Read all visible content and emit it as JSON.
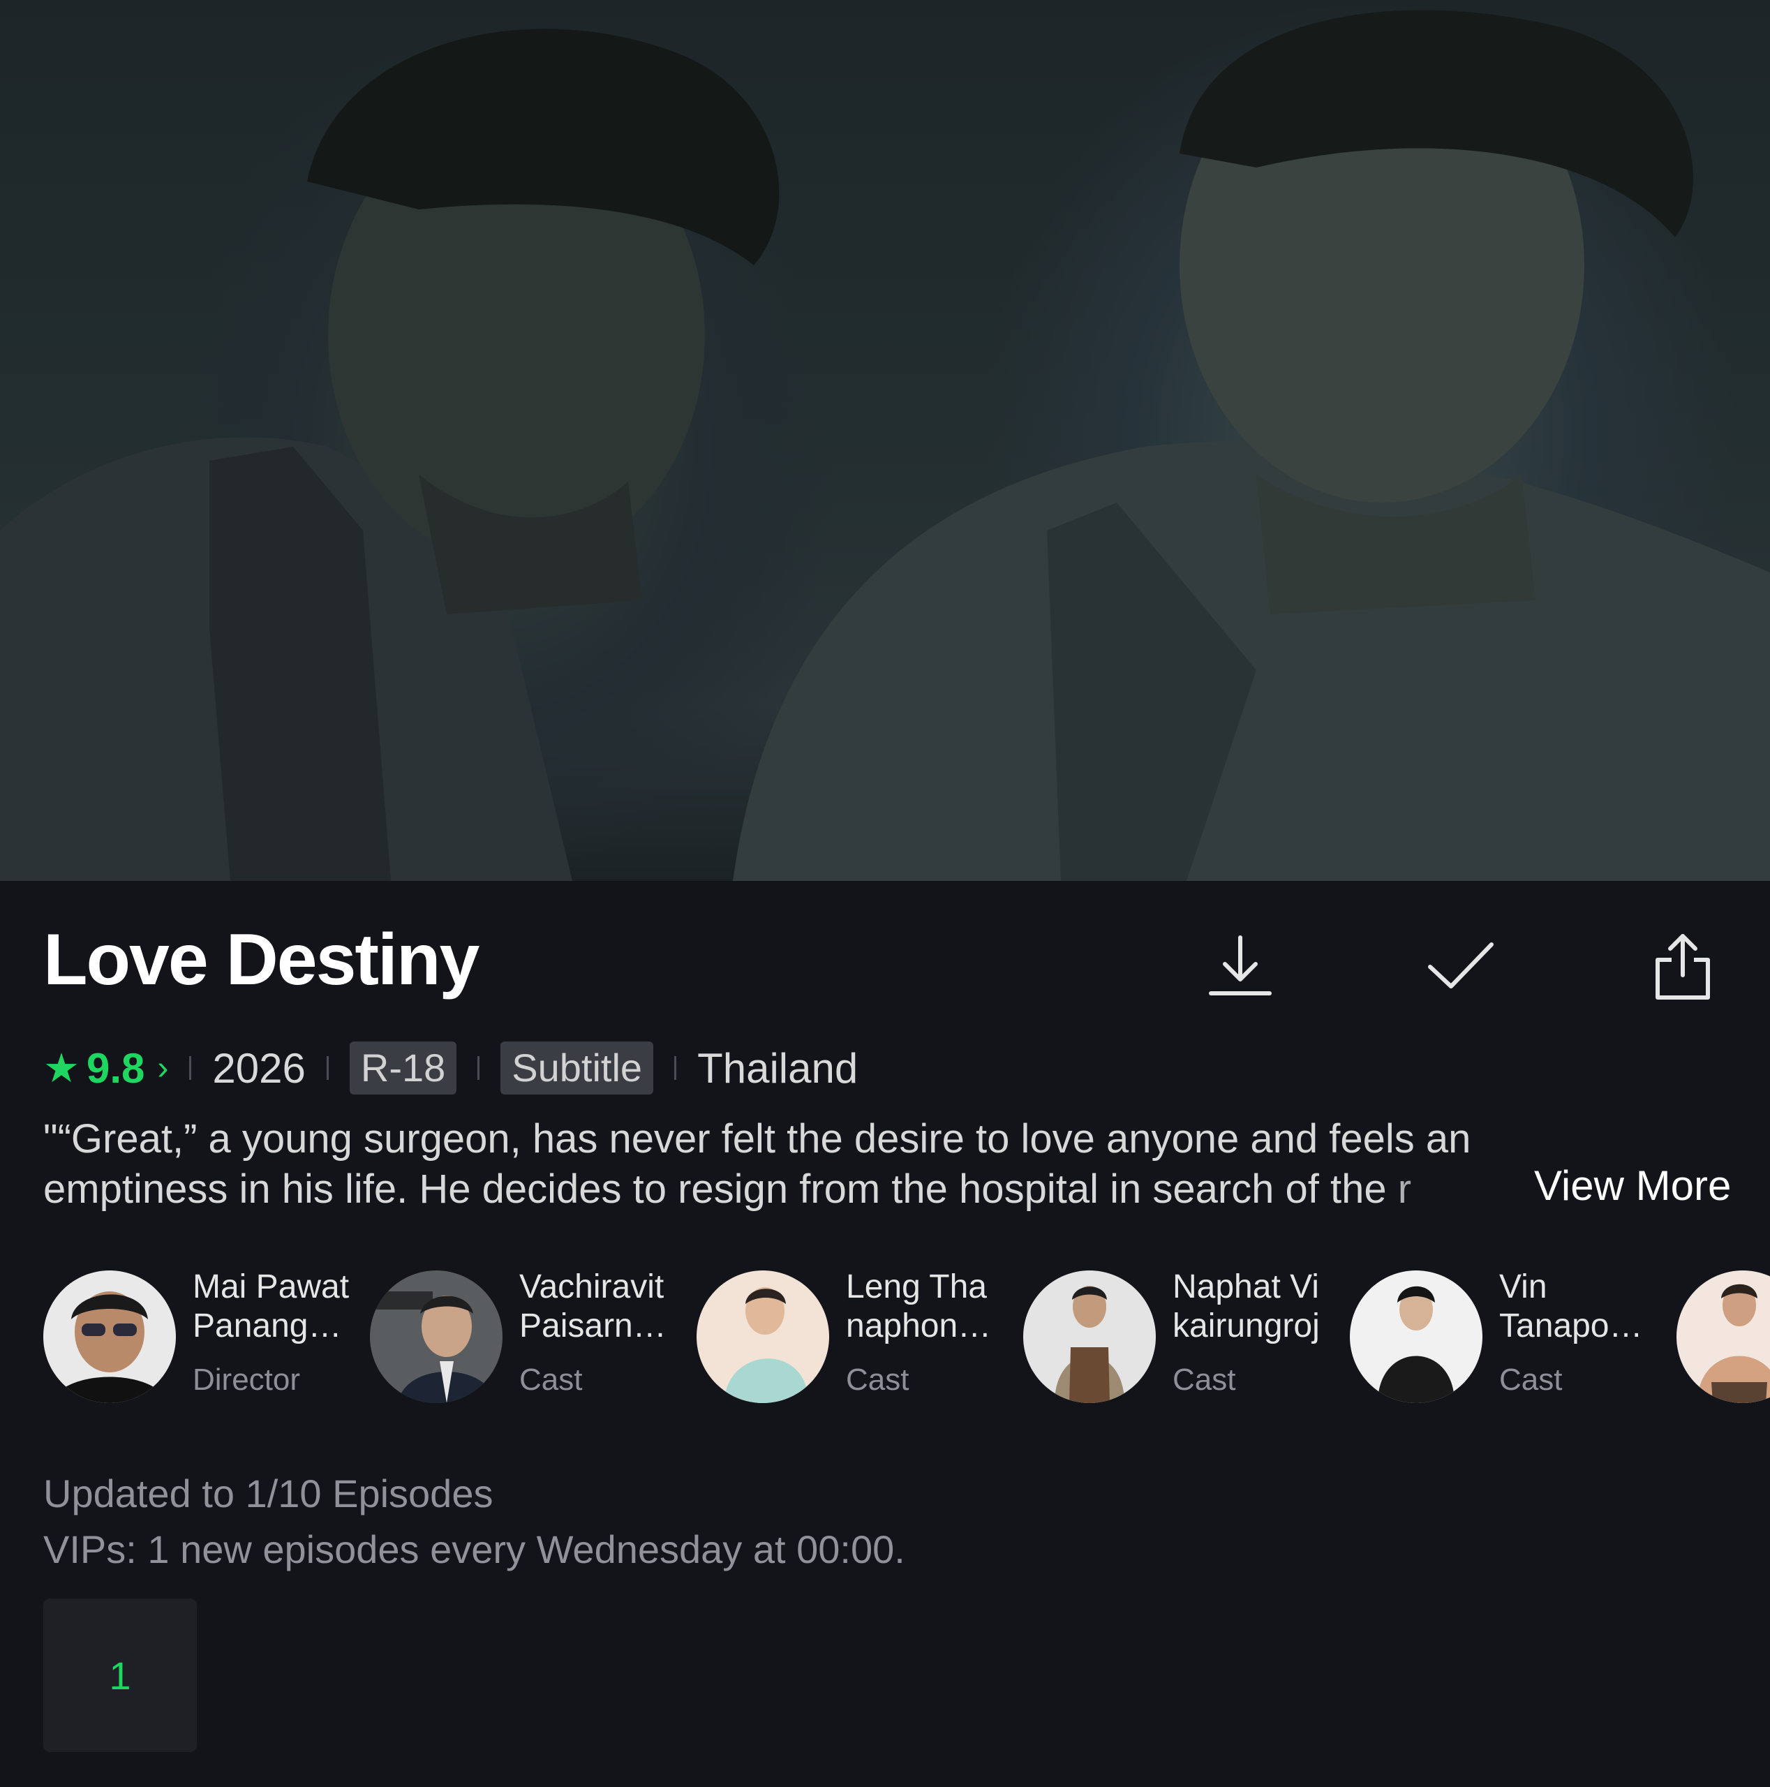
{
  "show": {
    "title": "Love Destiny",
    "rating": "9.8",
    "rating_chevron": "›",
    "year": "2026",
    "age_rating": "R-18",
    "subtitle_tag": "Subtitle",
    "country": "Thailand",
    "synopsis_line1": "\"“Great,” a young surgeon, has never felt the desire to love anyone and feels an",
    "synopsis_line2": "emptiness in his life. He decides to resign from the hospital in search of the r",
    "view_more": "View More"
  },
  "actions": {
    "download_icon": "download-icon",
    "added_icon": "checkmark-icon",
    "share_icon": "share-icon"
  },
  "cast": [
    {
      "name_line1": "Mai Pawat",
      "name_line2": "Panang…",
      "role": "Director"
    },
    {
      "name_line1": "Vachiravit",
      "name_line2": "Paisarn…",
      "role": "Cast"
    },
    {
      "name_line1": "Leng Tha",
      "name_line2": "naphon…",
      "role": "Cast"
    },
    {
      "name_line1": "Naphat Vi",
      "name_line2": "kairungroj",
      "role": "Cast"
    },
    {
      "name_line1": "Vin",
      "name_line2": "Tanapo…",
      "role": "Cast"
    }
  ],
  "schedule": {
    "updated": "Updated to 1/10 Episodes",
    "vip_note": "VIPs: 1 new episodes every Wednesday at 00:00."
  },
  "episodes": [
    {
      "label": "1"
    }
  ],
  "colors": {
    "accent": "#1ed760",
    "background": "#12141a"
  }
}
